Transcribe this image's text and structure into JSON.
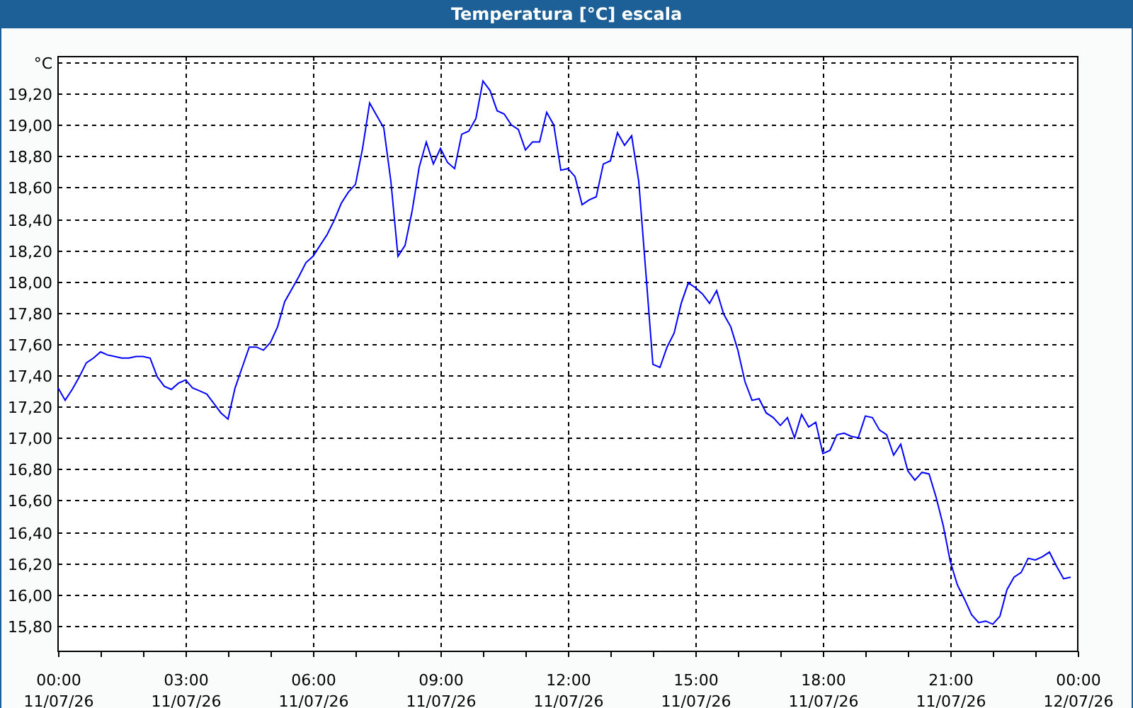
{
  "window": {
    "title": "Temperatura [°C] escala"
  },
  "chart": {
    "chart_data": {
      "type": "line",
      "grid": true,
      "ylim": [
        15.636,
        19.436
      ],
      "categories": [
        "00:00\n11/07/26",
        null,
        null,
        null,
        null,
        null,
        null,
        null,
        null,
        null,
        null,
        null,
        null,
        null,
        null,
        null,
        null,
        null,
        "03:00\n11/07/26",
        null,
        null,
        null,
        null,
        null,
        null,
        null,
        null,
        null,
        null,
        null,
        null,
        null,
        null,
        null,
        null,
        null,
        "06:00\n11/07/26",
        null,
        null,
        null,
        null,
        null,
        null,
        null,
        null,
        null,
        null,
        null,
        null,
        null,
        null,
        null,
        null,
        null,
        "09:00\n11/07/26",
        null,
        null,
        null,
        null,
        null,
        null,
        null,
        null,
        null,
        null,
        null,
        null,
        null,
        null,
        null,
        null,
        null,
        "12:00\n11/07/26",
        null,
        null,
        null,
        null,
        null,
        null,
        null,
        null,
        null,
        null,
        null,
        null,
        null,
        null,
        null,
        null,
        null,
        "15:00\n11/07/26",
        null,
        null,
        null,
        null,
        null,
        null,
        null,
        null,
        null,
        null,
        null,
        null,
        null,
        null,
        null,
        null,
        null,
        "18:00\n11/07/26",
        null,
        null,
        null,
        null,
        null,
        null,
        null,
        null,
        null,
        null,
        null,
        null,
        null,
        null,
        null,
        null,
        null,
        "21:00\n11/07/26",
        null,
        null,
        null,
        null,
        null,
        null,
        null,
        null,
        null,
        null,
        null,
        null,
        null,
        null,
        null,
        null,
        null,
        "00:00\n12/07/26"
      ],
      "yticks": [
        {
          "value": 15.8,
          "label": "15,80"
        },
        {
          "value": 16.0,
          "label": "16,00"
        },
        {
          "value": 16.2,
          "label": "16,20"
        },
        {
          "value": 16.4,
          "label": "16,40"
        },
        {
          "value": 16.6,
          "label": "16,60"
        },
        {
          "value": 16.8,
          "label": "16,80"
        },
        {
          "value": 17.0,
          "label": "17,00"
        },
        {
          "value": 17.2,
          "label": "17,20"
        },
        {
          "value": 17.4,
          "label": "17,40"
        },
        {
          "value": 17.6,
          "label": "17,60"
        },
        {
          "value": 17.8,
          "label": "17,80"
        },
        {
          "value": 18.0,
          "label": "18,00"
        },
        {
          "value": 18.2,
          "label": "18,20"
        },
        {
          "value": 18.4,
          "label": "18,40"
        },
        {
          "value": 18.6,
          "label": "18,60"
        },
        {
          "value": 18.8,
          "label": "18,80"
        },
        {
          "value": 19.0,
          "label": "19,00"
        },
        {
          "value": 19.2,
          "label": "19,20"
        },
        {
          "value": 19.4,
          "label": "°C"
        }
      ],
      "series": [
        {
          "color": "#0000ff",
          "values": [
            17.32,
            17.24,
            17.31,
            17.39,
            17.48,
            17.51,
            17.55,
            17.53,
            17.52,
            17.51,
            17.51,
            17.52,
            17.52,
            17.51,
            17.39,
            17.33,
            17.31,
            17.35,
            17.37,
            17.32,
            17.3,
            17.28,
            17.22,
            17.16,
            17.12,
            17.32,
            17.45,
            17.58,
            17.58,
            17.56,
            17.61,
            17.71,
            17.87,
            17.95,
            18.03,
            18.12,
            18.16,
            18.23,
            18.3,
            18.39,
            18.5,
            18.57,
            18.62,
            18.85,
            19.14,
            19.06,
            18.98,
            18.64,
            18.16,
            18.23,
            18.45,
            18.73,
            18.89,
            18.75,
            18.85,
            18.76,
            18.72,
            18.94,
            18.96,
            19.04,
            19.28,
            19.22,
            19.09,
            19.07,
            19.0,
            18.97,
            18.84,
            18.89,
            18.89,
            19.08,
            19.0,
            18.71,
            18.72,
            18.67,
            18.49,
            18.52,
            18.54,
            18.75,
            18.77,
            18.95,
            18.87,
            18.93,
            18.64,
            18.06,
            17.47,
            17.45,
            17.58,
            17.67,
            17.86,
            17.99,
            17.96,
            17.92,
            17.86,
            17.94,
            17.79,
            17.71,
            17.56,
            17.36,
            17.24,
            17.25,
            17.16,
            17.13,
            17.08,
            17.13,
            17.0,
            17.15,
            17.07,
            17.1,
            16.9,
            16.92,
            17.02,
            17.03,
            17.01,
            17.0,
            17.14,
            17.13,
            17.05,
            17.02,
            16.89,
            16.96,
            16.79,
            16.73,
            16.78,
            16.77,
            16.62,
            16.44,
            16.21,
            16.06,
            15.97,
            15.87,
            15.82,
            15.83,
            15.81,
            15.86,
            16.03,
            16.11,
            16.14,
            16.23,
            16.22,
            16.24,
            16.27,
            16.18,
            16.1,
            16.11,
            null
          ]
        }
      ]
    }
  }
}
